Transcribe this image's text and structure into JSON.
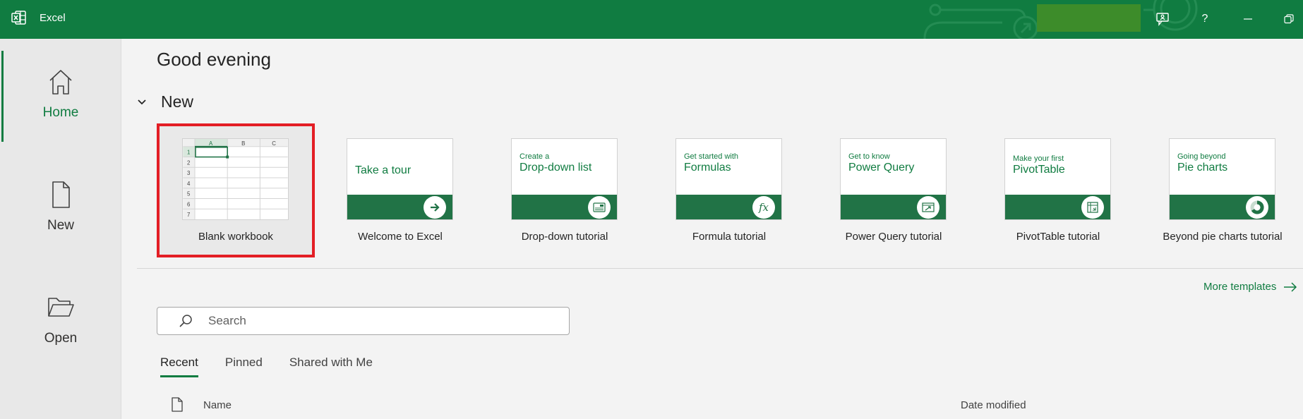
{
  "app": {
    "title": "Excel"
  },
  "titlebar": {
    "feedback_icon": "feedback-icon",
    "help_label": "?",
    "minimize_icon": "minimize-icon",
    "restore_icon": "restore-icon"
  },
  "sidebar": {
    "items": [
      {
        "label": "Home",
        "icon": "home-icon",
        "active": true
      },
      {
        "label": "New",
        "icon": "new-document-icon",
        "active": false
      },
      {
        "label": "Open",
        "icon": "folder-open-icon",
        "active": false
      }
    ]
  },
  "main": {
    "greeting": "Good evening",
    "new_section": {
      "title": "New",
      "templates": [
        {
          "label": "Blank workbook",
          "kind": "blank",
          "selected": true,
          "grid_cols": [
            "A",
            "B",
            "C"
          ],
          "grid_rows": [
            "1",
            "2",
            "3",
            "4",
            "5",
            "6",
            "7"
          ]
        },
        {
          "label": "Welcome to Excel",
          "sub": "",
          "main": "Take a tour",
          "badge": "arrow-right-icon"
        },
        {
          "label": "Drop-down tutorial",
          "sub": "Create a",
          "main": "Drop-down list",
          "badge": "dropdown-icon"
        },
        {
          "label": "Formula tutorial",
          "sub": "Get started with",
          "main": "Formulas",
          "badge": "fx-icon"
        },
        {
          "label": "Power Query tutorial",
          "sub": "Get to know",
          "main": "Power Query",
          "badge": "power-query-icon"
        },
        {
          "label": "PivotTable tutorial",
          "sub": "Make your first",
          "main": "PivotTable",
          "badge": "pivot-table-icon"
        },
        {
          "label": "Beyond pie charts tutorial",
          "sub": "Going beyond",
          "main": "Pie charts",
          "badge": "donut-chart-icon"
        }
      ]
    },
    "more_templates": "More templates",
    "search": {
      "placeholder": "Search",
      "value": ""
    },
    "tabs": [
      {
        "label": "Recent",
        "active": true
      },
      {
        "label": "Pinned",
        "active": false
      },
      {
        "label": "Shared with Me",
        "active": false
      }
    ],
    "list_header": {
      "name": "Name",
      "date_modified": "Date modified"
    }
  },
  "colors": {
    "brand_green": "#107c41",
    "band_green": "#217346",
    "selection_red": "#e31e25"
  }
}
